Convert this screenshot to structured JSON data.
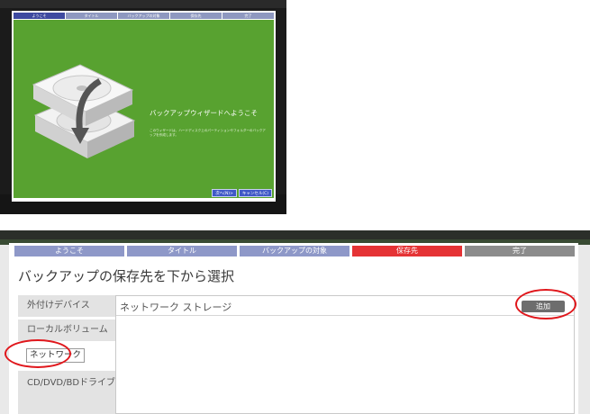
{
  "small_wizard": {
    "tabs": [
      {
        "label": "ようこそ",
        "active": true
      },
      {
        "label": "タイトル",
        "active": false
      },
      {
        "label": "バックアップの対象",
        "active": false
      },
      {
        "label": "保存先",
        "active": false
      },
      {
        "label": "完了",
        "active": false
      }
    ],
    "title": "バックアップウィザードへようこそ",
    "description": "このウィザードは、ハードディスク上のパーティションやフォルダーのバックアップを作成します。",
    "buttons": {
      "next": "次へ(N)>",
      "cancel": "キャンセル(C)"
    },
    "panel_color": "#58a230",
    "illustration_icon": "hard-drive-backup-icon"
  },
  "large_wizard": {
    "tabs": [
      {
        "label": "ようこそ",
        "color": "#8e98c8"
      },
      {
        "label": "タイトル",
        "color": "#8e98c8"
      },
      {
        "label": "バックアップの対象",
        "color": "#8e98c8"
      },
      {
        "label": "保存先",
        "color": "#e53335"
      },
      {
        "label": "完了",
        "color": "#8c8c8c"
      }
    ],
    "heading": "バックアップの保存先を下から選択",
    "sidebar": {
      "items": [
        {
          "label": "外付けデバイス"
        },
        {
          "label": "ローカルボリューム"
        },
        {
          "label": "ネットワーク",
          "selected": true
        },
        {
          "label": "CD/DVD/BDドライブ"
        }
      ]
    },
    "content": {
      "storage_label": "ネットワーク ストレージ",
      "add_label": "追加"
    },
    "highlight_color": "#e0171c"
  }
}
